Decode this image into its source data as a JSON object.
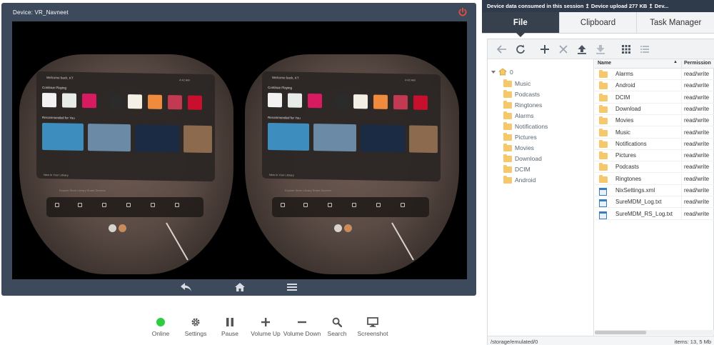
{
  "device": {
    "title": "Device: VR_Navneet",
    "vr": {
      "user": "Welcome back, KT",
      "status": "4:42 AM",
      "continue_playing": "Continue Playing",
      "recommended": "Recommended for You",
      "library": "New in Your Library",
      "dock_labels": "Explore   Store   Library   Share   Devices",
      "tile_colors": [
        "#f2f2f2",
        "#e8ece8",
        "#d81b60",
        "#2b2b2b",
        "#f5f0e6",
        "#f08a3c",
        "#c23a52",
        "#c8102e"
      ],
      "thumb_colors": [
        "#3d8dbf",
        "#6b8aa6",
        "#1b2b44",
        "#8b6a4e"
      ]
    }
  },
  "device_nav": {
    "back": "back-icon",
    "home": "home-icon",
    "menu": "menu-icon"
  },
  "toolbar": {
    "online": "Online",
    "settings": "Settings",
    "pause": "Pause",
    "volume_up": "Volume Up",
    "volume_down": "Volume Down",
    "search": "Search",
    "screenshot": "Screenshot"
  },
  "data_bar": {
    "text": "Device data consumed in this session  ↥ Device upload 277 KB  ↥ Dev..."
  },
  "tabs": [
    {
      "label": "File",
      "active": true
    },
    {
      "label": "Clipboard",
      "active": false
    },
    {
      "label": "Task Manager",
      "active": false
    }
  ],
  "file_manager": {
    "root": "0",
    "tree": [
      "Music",
      "Podcasts",
      "Ringtones",
      "Alarms",
      "Notifications",
      "Pictures",
      "Movies",
      "Download",
      "DCIM",
      "Android"
    ],
    "columns": {
      "name": "Name",
      "permission": "Permission"
    },
    "files": [
      {
        "name": "Alarms",
        "type": "folder",
        "perm": "read/write"
      },
      {
        "name": "Android",
        "type": "folder",
        "perm": "read/write"
      },
      {
        "name": "DCIM",
        "type": "folder",
        "perm": "read/write"
      },
      {
        "name": "Download",
        "type": "folder",
        "perm": "read/write"
      },
      {
        "name": "Movies",
        "type": "folder",
        "perm": "read/write"
      },
      {
        "name": "Music",
        "type": "folder",
        "perm": "read/write"
      },
      {
        "name": "Notifications",
        "type": "folder",
        "perm": "read/write"
      },
      {
        "name": "Pictures",
        "type": "folder",
        "perm": "read/write"
      },
      {
        "name": "Podcasts",
        "type": "folder",
        "perm": "read/write"
      },
      {
        "name": "Ringtones",
        "type": "folder",
        "perm": "read/write"
      },
      {
        "name": "NixSettings.xml",
        "type": "file",
        "perm": "read/write"
      },
      {
        "name": "SureMDM_Log.txt",
        "type": "file",
        "perm": "read/write"
      },
      {
        "name": "SureMDM_RS_Log.txt",
        "type": "file",
        "perm": "read/write"
      }
    ],
    "path": "/storage/emulated/0",
    "items_count": "items: 13, 5 Mb"
  },
  "colors": {
    "panel_bg": "#3c4a5c",
    "tab_active": "#37404d",
    "online_green": "#2ecc40",
    "power_red": "#e74c3c",
    "folder_yellow": "#f5c96b"
  }
}
